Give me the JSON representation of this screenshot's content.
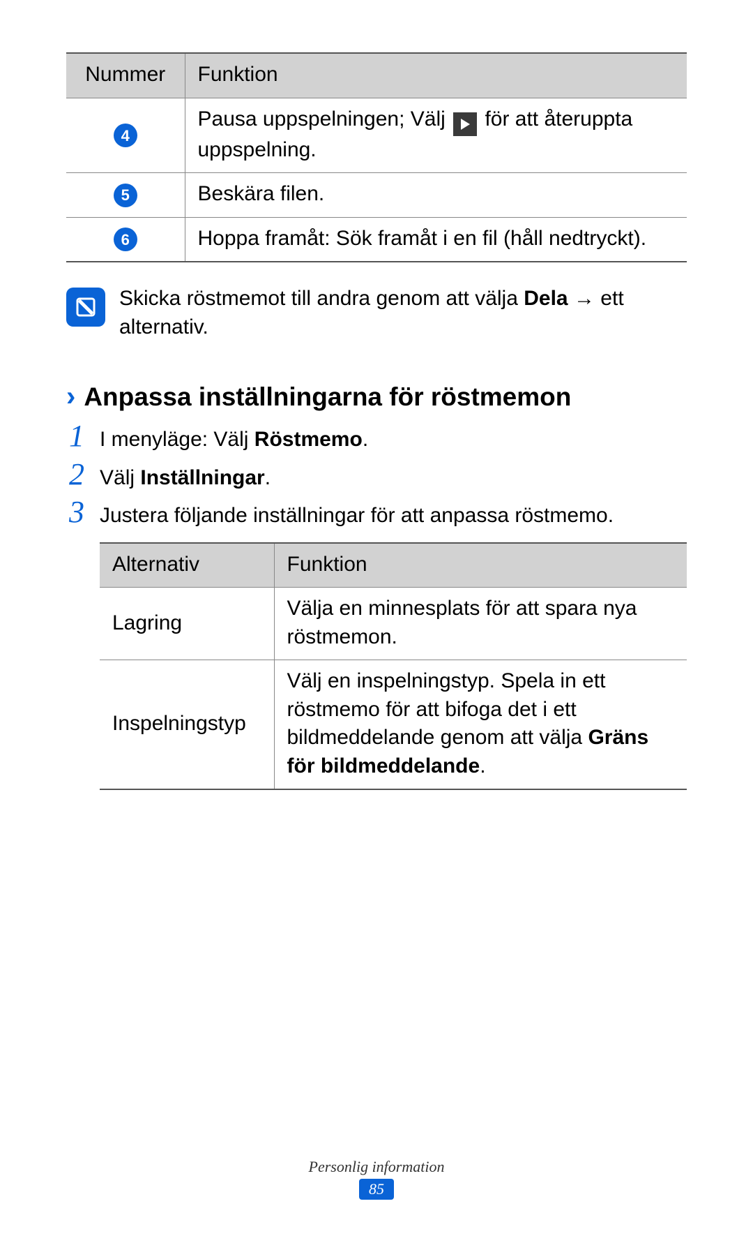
{
  "table1": {
    "headers": {
      "number": "Nummer",
      "function": "Funktion"
    },
    "rows": [
      {
        "num": "4",
        "func_before": "Pausa uppspelningen; Välj ",
        "func_after": " för att återuppta uppspelning."
      },
      {
        "num": "5",
        "func": "Beskära filen."
      },
      {
        "num": "6",
        "func": "Hoppa framåt: Sök framåt i en fil (håll nedtryckt)."
      }
    ]
  },
  "note": {
    "text_before": "Skicka röstmemot till andra genom att välja ",
    "bold": "Dela",
    "text_after": " → ett alternativ."
  },
  "section_heading": "Anpassa inställningarna för röstmemon",
  "steps": [
    {
      "num": "1",
      "before": "I menyläge: Välj ",
      "bold": "Röstmemo",
      "after": "."
    },
    {
      "num": "2",
      "before": "Välj ",
      "bold": "Inställningar",
      "after": "."
    },
    {
      "num": "3",
      "before": "Justera följande inställningar för att anpassa röstmemo.",
      "bold": "",
      "after": ""
    }
  ],
  "table2": {
    "headers": {
      "option": "Alternativ",
      "function": "Funktion"
    },
    "rows": [
      {
        "option": "Lagring",
        "func": "Välja en minnesplats för att spara nya röstmemon."
      },
      {
        "option": "Inspelningstyp",
        "func_before": "Välj en inspelningstyp. Spela in ett röstmemo för att bifoga det i ett bildmeddelande genom att välja ",
        "bold": "Gräns för bildmeddelande",
        "func_after": "."
      }
    ]
  },
  "footer": {
    "section": "Personlig information",
    "page": "85"
  }
}
